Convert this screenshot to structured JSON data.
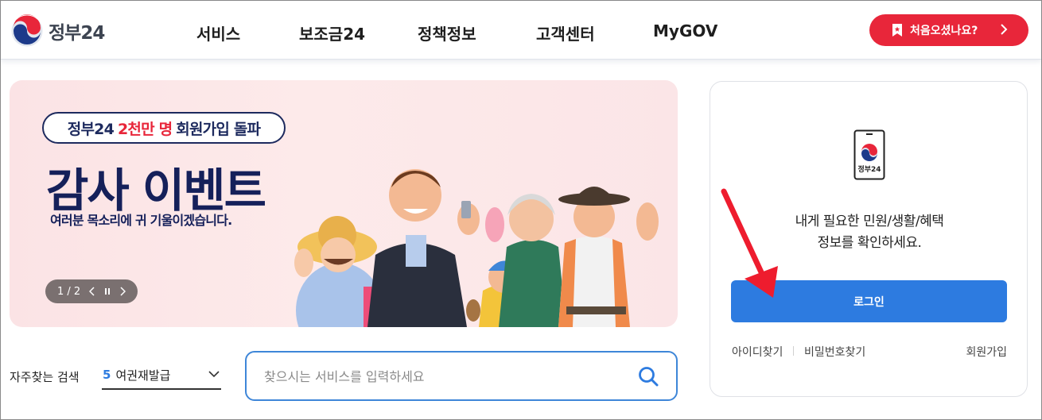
{
  "header": {
    "logo_text": "정부24",
    "nav": [
      "서비스",
      "보조금24",
      "정책정보",
      "고객센터",
      "MyGOV"
    ],
    "first_visit_label": "처음오셨나요?"
  },
  "banner": {
    "pill_prefix": "정부24",
    "pill_accent": "2천만 명",
    "pill_suffix": "회원가입 돌파",
    "title": "감사 이벤트",
    "subtitle": "여러분 목소리에 귀 기울이겠습니다.",
    "pager": "1 / 2"
  },
  "login": {
    "app_label": "정부24",
    "message_line1": "내게 필요한 민원/생활/혜택",
    "message_line2": "정보를 확인하세요.",
    "button": "로그인",
    "find_id": "아이디찾기",
    "find_pw": "비밀번호찾기",
    "signup": "회원가입"
  },
  "search": {
    "frequent_label": "자주찾는 검색",
    "frequent_rank": "5",
    "frequent_item": "여권재발급",
    "placeholder": "찾으시는 서비스를 입력하세요"
  },
  "colors": {
    "brand_red": "#e8263a",
    "brand_blue": "#2d7be0",
    "navy": "#15205a",
    "arrow_red": "#ee1c2e"
  }
}
